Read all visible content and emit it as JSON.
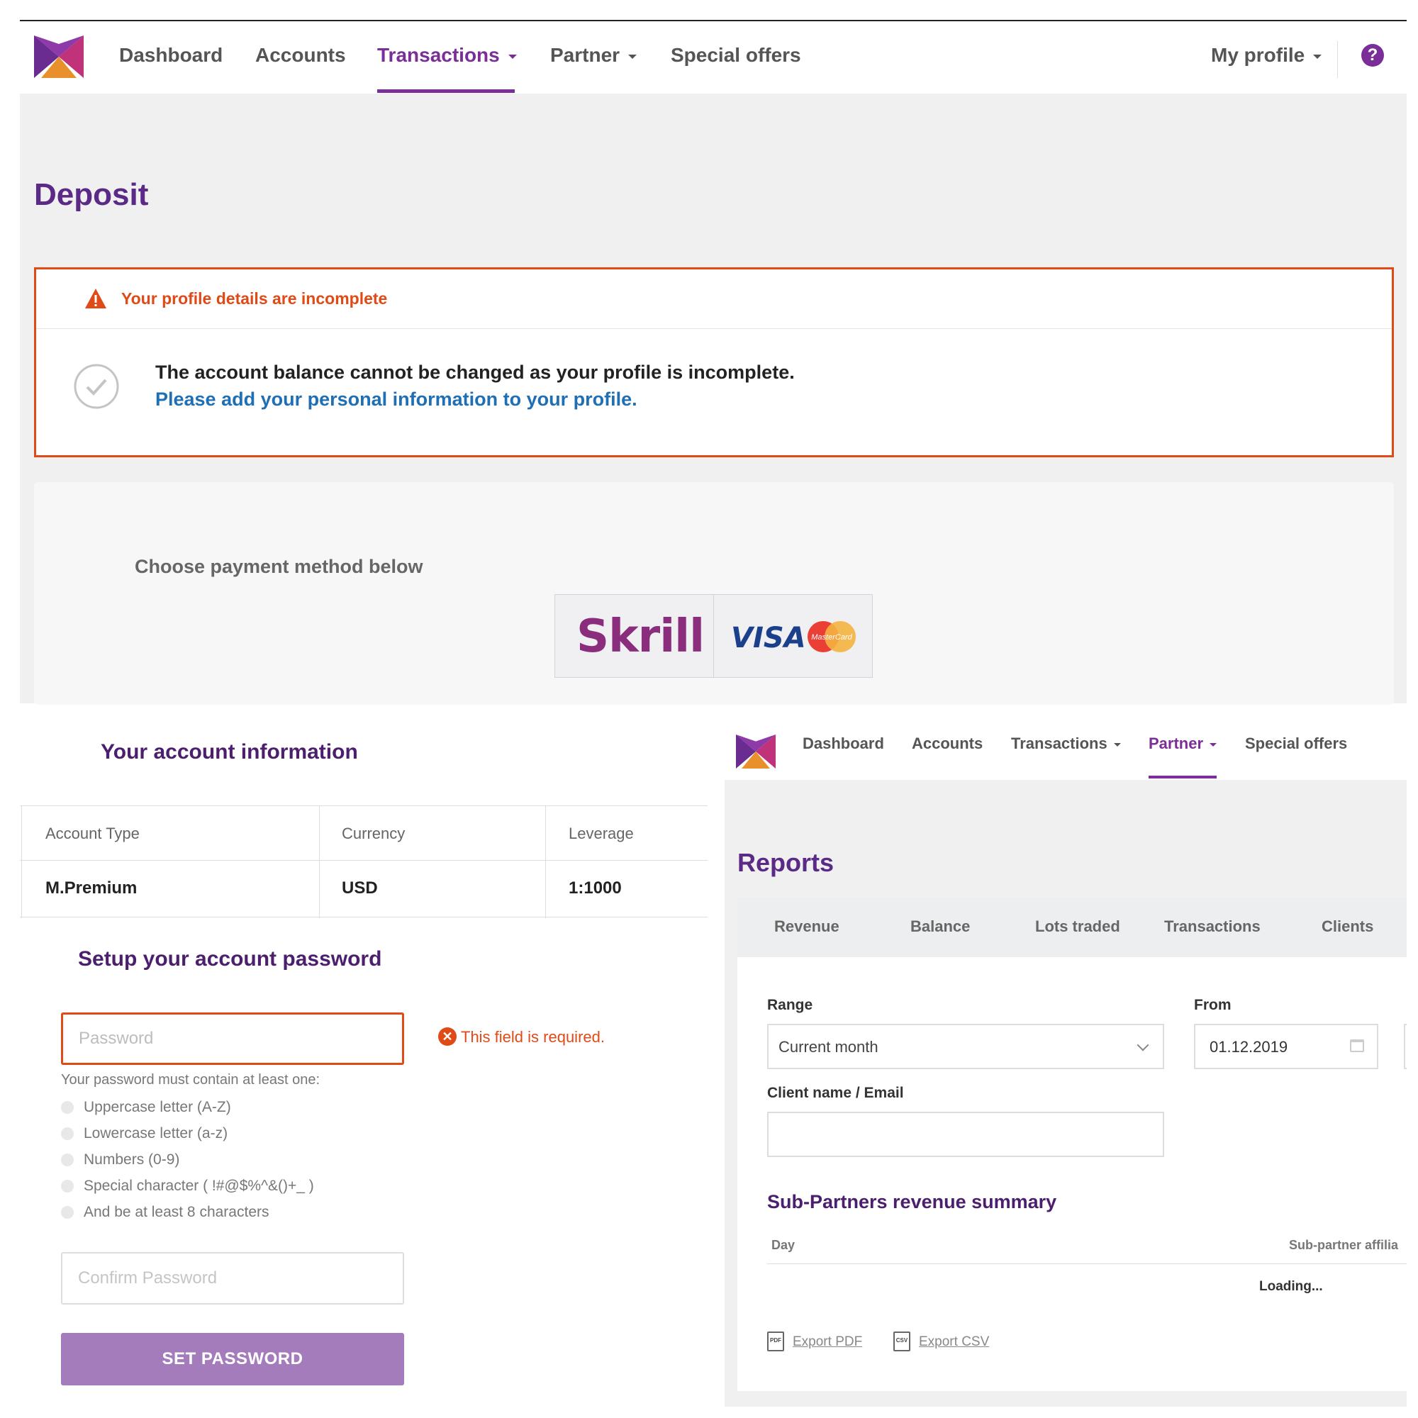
{
  "top": {
    "nav": {
      "items": [
        "Dashboard",
        "Accounts",
        "Transactions",
        "Partner",
        "Special offers"
      ],
      "active": "Transactions",
      "profile": "My profile",
      "help": "?"
    },
    "page_title": "Deposit",
    "alert": {
      "title": "Your profile details are incomplete",
      "message": "The account balance cannot be changed as your profile is incomplete.",
      "link": "Please add your personal information to your profile."
    },
    "payment": {
      "label": "Choose payment method below",
      "skrill": "Skrill",
      "visa": "VISA",
      "mastercard": "MasterCard"
    }
  },
  "account": {
    "title": "Your account information",
    "headers": [
      "Account Type",
      "Currency",
      "Leverage"
    ],
    "values": [
      "M.Premium",
      "USD",
      "1:1000"
    ]
  },
  "password": {
    "title": "Setup your account password",
    "placeholder": "Password",
    "error": "This field is required.",
    "rules_intro": "Your password must contain at least one:",
    "rules": [
      "Uppercase letter (A-Z)",
      "Lowercase letter (a-z)",
      "Numbers (0-9)",
      "Special character ( !#@$%^&()+_ )",
      "And be at least 8 characters"
    ],
    "confirm_placeholder": "Confirm Password",
    "button": "SET PASSWORD"
  },
  "partner": {
    "nav": {
      "items": [
        "Dashboard",
        "Accounts",
        "Transactions",
        "Partner",
        "Special offers"
      ],
      "active": "Partner"
    },
    "title": "Reports",
    "tabs": [
      "Revenue",
      "Balance",
      "Lots traded",
      "Transactions",
      "Clients"
    ],
    "range_label": "Range",
    "range_value": "Current month",
    "from_label": "From",
    "from_value": "01.12.2019",
    "client_label": "Client name / Email",
    "summary_title": "Sub-Partners revenue summary",
    "col_day": "Day",
    "col_affiliate": "Sub-partner affilia",
    "loading": "Loading...",
    "export_pdf": "Export PDF",
    "export_csv": "Export CSV"
  },
  "colors": {
    "brand": "#7b2e98",
    "title": "#5b2a86",
    "alert": "#e04a17",
    "link": "#1f6fb5",
    "button": "#a47cbc"
  }
}
